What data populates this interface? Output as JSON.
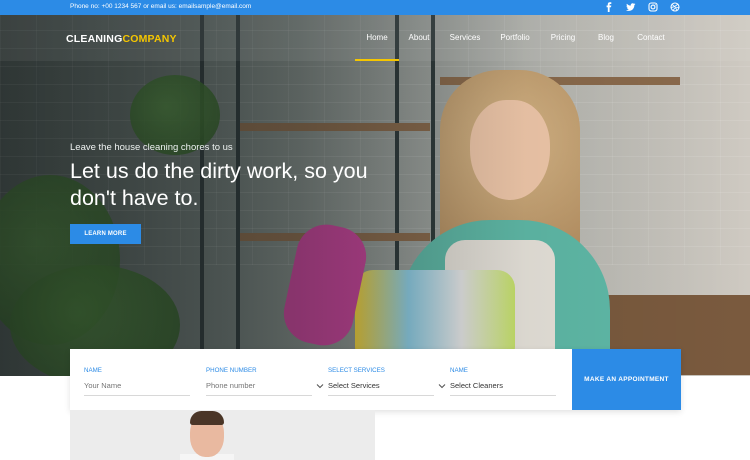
{
  "topbar": {
    "phone_label": "Phone no: ",
    "phone": "+00 1234 567",
    "email_label": " or email us: ",
    "email": "emailsample@email.com",
    "social_icons": [
      "facebook-icon",
      "twitter-icon",
      "instagram-icon",
      "dribbble-icon"
    ]
  },
  "brand": {
    "name_part1": "CLEANING",
    "name_part2": "COMPANY",
    "accent_color": "#f5c600"
  },
  "nav": {
    "items": [
      {
        "label": "Home",
        "active": true
      },
      {
        "label": "About"
      },
      {
        "label": "Services"
      },
      {
        "label": "Portfolio"
      },
      {
        "label": "Pricing"
      },
      {
        "label": "Blog"
      },
      {
        "label": "Contact"
      }
    ]
  },
  "hero": {
    "kicker": "Leave the house cleaning chores to us",
    "headline": "Let us do the dirty work, so you don't have to.",
    "cta_label": "LEARN MORE"
  },
  "booking_form": {
    "fields": [
      {
        "label": "NAME",
        "placeholder": "Your Name"
      },
      {
        "label": "PHONE NUMBER",
        "placeholder": "Phone number"
      },
      {
        "label": "SELECT SERVICES",
        "value": "Select Services"
      },
      {
        "label": "NAME",
        "value": "Select Cleaners"
      }
    ],
    "submit_label": "MAKE AN APPOINTMENT"
  },
  "colors": {
    "primary": "#2c8be6",
    "accent": "#f5c600"
  }
}
